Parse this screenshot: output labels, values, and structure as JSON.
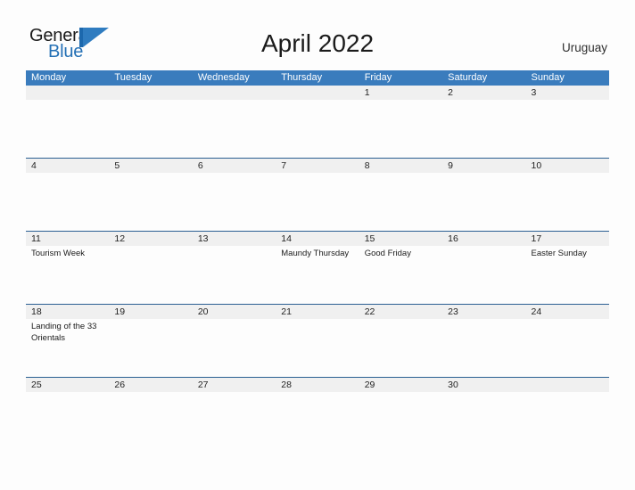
{
  "brand": {
    "word_one": "General",
    "word_two": "Blue",
    "mark_icon": "flag-triangle-icon",
    "color_dark": "#1b1b1b",
    "color_blue": "#2470b5"
  },
  "header": {
    "title": "April 2022",
    "region": "Uruguay",
    "header_bg": "#3a7cbd",
    "band_bg": "#f0f0f0",
    "rule_color": "#2a5f92"
  },
  "weekdays": [
    "Monday",
    "Tuesday",
    "Wednesday",
    "Thursday",
    "Friday",
    "Saturday",
    "Sunday"
  ],
  "weeks": [
    {
      "days": [
        {
          "num": "",
          "event": ""
        },
        {
          "num": "",
          "event": ""
        },
        {
          "num": "",
          "event": ""
        },
        {
          "num": "",
          "event": ""
        },
        {
          "num": "1",
          "event": ""
        },
        {
          "num": "2",
          "event": ""
        },
        {
          "num": "3",
          "event": ""
        }
      ]
    },
    {
      "days": [
        {
          "num": "4",
          "event": ""
        },
        {
          "num": "5",
          "event": ""
        },
        {
          "num": "6",
          "event": ""
        },
        {
          "num": "7",
          "event": ""
        },
        {
          "num": "8",
          "event": ""
        },
        {
          "num": "9",
          "event": ""
        },
        {
          "num": "10",
          "event": ""
        }
      ]
    },
    {
      "days": [
        {
          "num": "11",
          "event": "Tourism Week"
        },
        {
          "num": "12",
          "event": ""
        },
        {
          "num": "13",
          "event": ""
        },
        {
          "num": "14",
          "event": "Maundy Thursday"
        },
        {
          "num": "15",
          "event": "Good Friday"
        },
        {
          "num": "16",
          "event": ""
        },
        {
          "num": "17",
          "event": "Easter Sunday"
        }
      ]
    },
    {
      "days": [
        {
          "num": "18",
          "event": "Landing of the 33 Orientals"
        },
        {
          "num": "19",
          "event": ""
        },
        {
          "num": "20",
          "event": ""
        },
        {
          "num": "21",
          "event": ""
        },
        {
          "num": "22",
          "event": ""
        },
        {
          "num": "23",
          "event": ""
        },
        {
          "num": "24",
          "event": ""
        }
      ]
    },
    {
      "days": [
        {
          "num": "25",
          "event": ""
        },
        {
          "num": "26",
          "event": ""
        },
        {
          "num": "27",
          "event": ""
        },
        {
          "num": "28",
          "event": ""
        },
        {
          "num": "29",
          "event": ""
        },
        {
          "num": "30",
          "event": ""
        },
        {
          "num": "",
          "event": ""
        }
      ]
    }
  ]
}
